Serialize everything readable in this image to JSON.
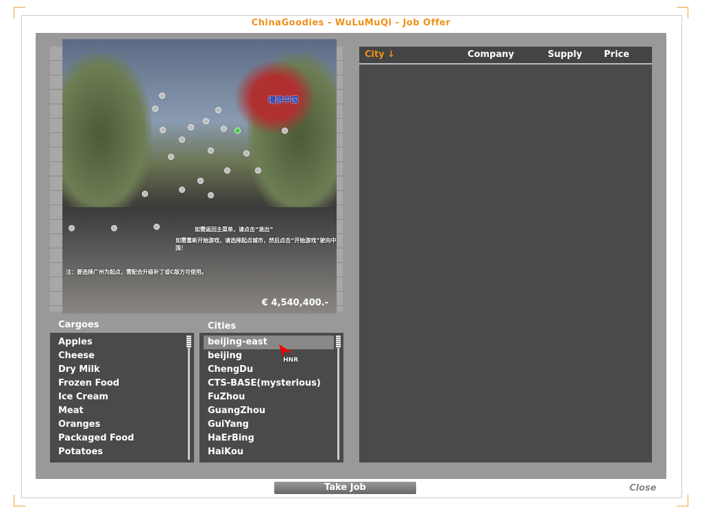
{
  "window": {
    "title": "ChinaGoodies - WuLuMuQi - Job Offer"
  },
  "preview": {
    "money": "€ 4,540,400.-",
    "logo_text": "漫游中国",
    "hint1": "如需返回主菜单，请点击“退出”",
    "hint2": "如需重新开始游戏，请选择起点城市，然后点击“开始游戏”驶向中国！",
    "note": "注：要选择广州为起点，需配合升级补丁或C版方可使用。",
    "cursor_label": "HNR"
  },
  "cargoes": {
    "label": "Cargoes",
    "items": [
      "Apples",
      "Cheese",
      "Dry Milk",
      "Frozen Food",
      "Ice Cream",
      "Meat",
      "Oranges",
      "Packaged Food",
      "Potatoes"
    ]
  },
  "cities": {
    "label": "Cities",
    "items": [
      "beijing-east",
      "beijing",
      "ChengDu",
      "CTS-BASE(mysterious)",
      "FuZhou",
      "GuangZhou",
      "GuiYang",
      "HaErBing",
      "HaiKou"
    ],
    "selected": "beijing-east"
  },
  "jobs": {
    "columns": {
      "city": "City ↓",
      "company": "Company",
      "supply": "Supply",
      "price": "Price"
    }
  },
  "buttons": {
    "take_job": "Take Job",
    "close": "Close"
  }
}
